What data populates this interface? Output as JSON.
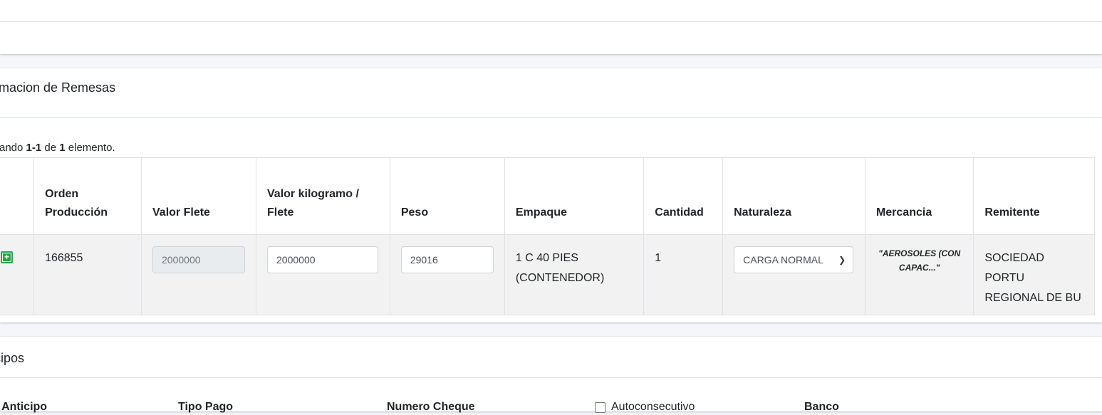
{
  "remesas": {
    "title": "rmacion de Remesas",
    "summary": {
      "prefix": "rando ",
      "range": "1-1",
      "mid": " de ",
      "total": "1",
      "suffix": " elemento."
    },
    "columns": [
      "",
      "Orden Producción",
      "Valor Flete",
      "Valor kilogramo / Flete",
      "Peso",
      "Empaque",
      "Cantidad",
      "Naturaleza",
      "Mercancia",
      "Remitente"
    ],
    "row": {
      "orden_produccion": "166855",
      "valor_flete": "2000000",
      "valor_kilogramo_flete": "2000000",
      "peso": "29016",
      "empaque": "1 C 40 PIES (CONTENEDOR)",
      "cantidad": "1",
      "naturaleza": "CARGA NORMAL",
      "mercancia": "\"AEROSOLES (CON CAPAC...\"",
      "remitente": "SOCIEDAD PORTU REGIONAL DE BU"
    }
  },
  "anticipos": {
    "title": "cipos",
    "labels": {
      "valor_anticipo": "r Anticipo",
      "tipo_pago": "Tipo Pago",
      "numero_cheque": "Numero Cheque",
      "autoconsecutivo": "Autoconsecutivo",
      "banco": "Banco"
    }
  },
  "icons": {
    "expand": "plus-square-icon",
    "select_chevron": "chevron-down-icon"
  },
  "colors": {
    "accent_green": "#28a745",
    "row_bg": "#f2f2f2",
    "border": "#dee2e6"
  }
}
